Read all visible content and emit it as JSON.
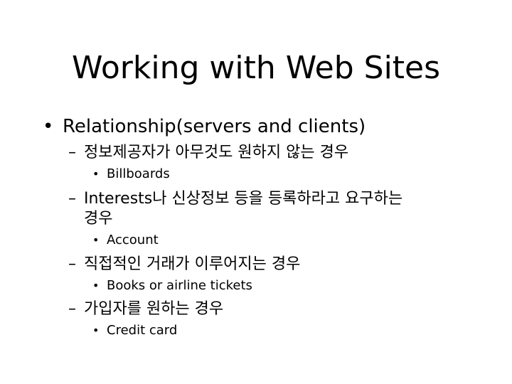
{
  "slide": {
    "title": "Working with Web Sites",
    "bullets": [
      {
        "marker": "•",
        "text": "Relationship(servers and clients)",
        "children": [
          {
            "marker": "–",
            "text": "정보제공자가 아무것도 원하지 않는 경우",
            "children": [
              {
                "marker": "•",
                "text": "Billboards"
              }
            ]
          },
          {
            "marker": "–",
            "text": "Interests나 신상정보 등을 등록하라고 요구하는",
            "text_cont": "경우",
            "children": [
              {
                "marker": "•",
                "text": "Account"
              }
            ]
          },
          {
            "marker": "–",
            "text": "직접적인 거래가 이루어지는 경우",
            "children": [
              {
                "marker": "•",
                "text": "Books or airline tickets"
              }
            ]
          },
          {
            "marker": "–",
            "text": "가입자를 원하는 경우",
            "children": [
              {
                "marker": "•",
                "text": "Credit card"
              }
            ]
          }
        ]
      }
    ]
  }
}
